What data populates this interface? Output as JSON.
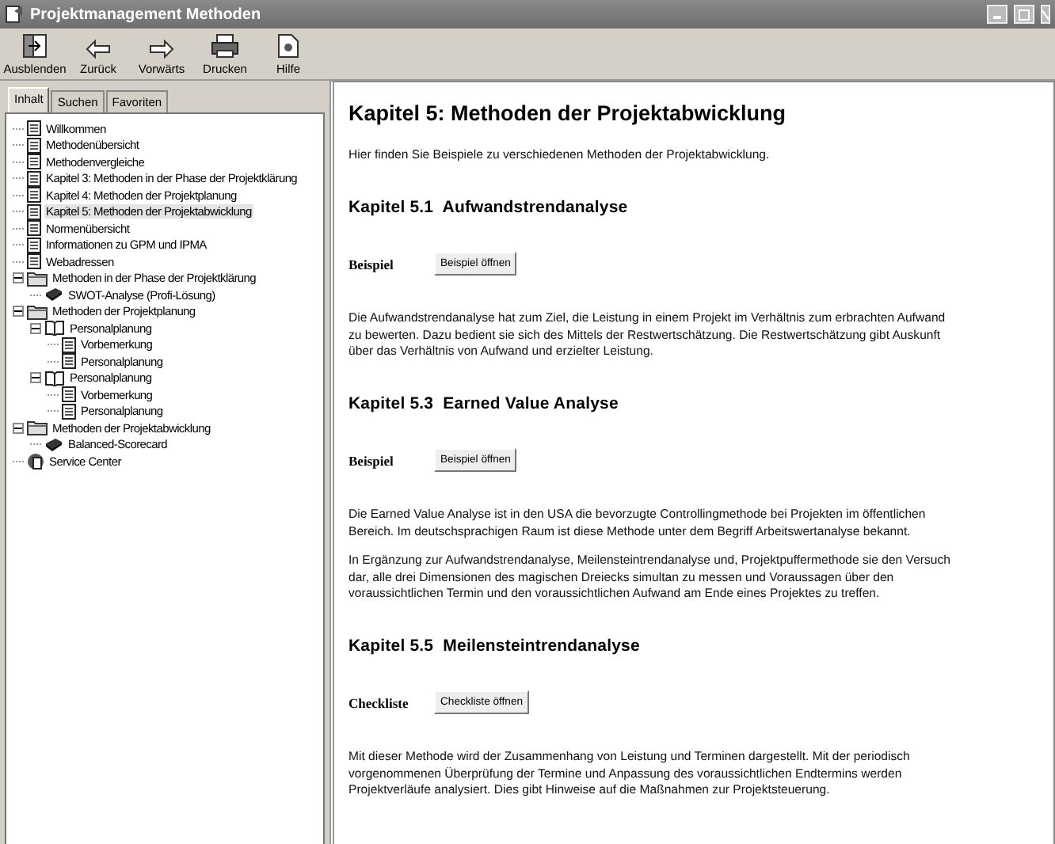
{
  "window": {
    "title": "Projektmanagement Methoden"
  },
  "toolbar": [
    {
      "kind": "hide",
      "label": "Ausblenden"
    },
    {
      "kind": "back",
      "label": "Zurück"
    },
    {
      "kind": "forward",
      "label": "Vorwärts"
    },
    {
      "kind": "print",
      "label": "Drucken"
    },
    {
      "kind": "help",
      "label": "Hilfe"
    }
  ],
  "tabs": [
    {
      "label": "Inhalt",
      "selected": true
    },
    {
      "label": "Suchen",
      "selected": false
    },
    {
      "label": "Favoriten",
      "selected": false
    }
  ],
  "tree": [
    {
      "kind": "page",
      "label": "Willkommen",
      "selected": false
    },
    {
      "kind": "page",
      "label": "Methodenübersicht",
      "selected": false
    },
    {
      "kind": "page",
      "label": "Methodenvergleiche",
      "selected": false
    },
    {
      "kind": "page",
      "label": "Kapitel 3: Methoden in der Phase der Projektklärung",
      "selected": false
    },
    {
      "kind": "page",
      "label": "Kapitel 4: Methoden der Projektplanung",
      "selected": false
    },
    {
      "kind": "page",
      "label": "Kapitel 5: Methoden der Projektabwicklung",
      "selected": true
    },
    {
      "kind": "page",
      "label": "Normenübersicht",
      "selected": false
    },
    {
      "kind": "page",
      "label": "Informationen zu GPM und IPMA",
      "selected": false
    },
    {
      "kind": "page",
      "label": "Webadressen",
      "selected": false
    },
    {
      "kind": "folder",
      "label": "Methoden in der Phase der Projektklärung",
      "selected": false,
      "expanded": true,
      "children": [
        {
          "kind": "book",
          "label": "SWOT-Analyse (Profi-Lösung)",
          "selected": false
        }
      ]
    },
    {
      "kind": "folder",
      "label": "Methoden der Projektplanung",
      "selected": false,
      "expanded": true,
      "children": [
        {
          "kind": "openbook",
          "label": "Personalplanung",
          "selected": false,
          "expanded": true,
          "children": [
            {
              "kind": "page",
              "label": "Vorbemerkung",
              "selected": false
            },
            {
              "kind": "page",
              "label": "Personalplanung",
              "selected": false
            }
          ]
        },
        {
          "kind": "openbook",
          "label": "Personalplanung",
          "selected": false,
          "expanded": true,
          "children": [
            {
              "kind": "page",
              "label": "Vorbemerkung",
              "selected": false
            },
            {
              "kind": "page",
              "label": "Personalplanung",
              "selected": false
            }
          ]
        }
      ]
    },
    {
      "kind": "folder",
      "label": "Methoden der Projektabwicklung",
      "selected": false,
      "expanded": true,
      "children": [
        {
          "kind": "book",
          "label": "Balanced-Scorecard",
          "selected": false
        }
      ]
    },
    {
      "kind": "service",
      "label": "Service Center",
      "selected": false
    }
  ],
  "content": {
    "title": "Kapitel 5: Methoden der Projektabwicklung",
    "intro": "Hier finden Sie Beispiele zu verschiedenen Methoden der Projektabwicklung.",
    "sections": [
      {
        "heading": "Kapitel 5.1  Aufwandstrendanalyse",
        "label": "Beispiel",
        "button": "Beispiel öffnen",
        "paragraphs": [
          "Die Aufwandstrendanalyse hat zum Ziel, die Leistung in einem Projekt im Verhältnis zum erbrachten Aufwand zu bewerten. Dazu bedient sie sich des Mittels der Restwertschätzung. Die Restwertschätzung gibt Auskunft über das Verhältnis von Aufwand und erzielter Leistung."
        ]
      },
      {
        "heading": "Kapitel 5.3  Earned Value Analyse",
        "label": "Beispiel",
        "button": "Beispiel öffnen",
        "paragraphs": [
          "Die Earned Value Analyse ist in den USA die bevorzugte Controllingmethode bei Projekten im öffentlichen Bereich. Im deutschsprachigen Raum ist diese Methode unter dem Begriff Arbeitswertanalyse bekannt.",
          "In Ergänzung zur Aufwandstrendanalyse, Meilensteintrendanalyse und, Projektpuffermethode sie den Versuch dar, alle drei Dimensionen des magischen Dreiecks simultan zu messen und Voraussagen über den voraussichtlichen Termin und den voraussichtlichen Aufwand am Ende eines Projektes zu treffen."
        ]
      },
      {
        "heading": "Kapitel 5.5  Meilensteintrendanalyse",
        "label": "Checkliste",
        "button": "Checkliste öffnen",
        "paragraphs": [
          "Mit dieser Methode wird der Zusammenhang von Leistung und Terminen dargestellt. Mit der periodisch vorgenommenen Überprüfung der Termine und Anpassung des voraussichtlichen Endtermins werden Projektverläufe analysiert. Dies gibt Hinweise auf die Maßnahmen zur Projektsteuerung."
        ]
      }
    ]
  }
}
